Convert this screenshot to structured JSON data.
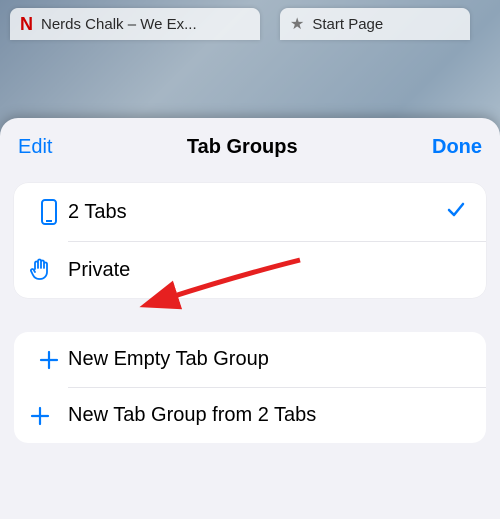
{
  "tabs_row": {
    "tab1": {
      "favicon_letter": "N",
      "title": "Nerds Chalk – We Ex..."
    },
    "tab2": {
      "title": "Start Page"
    }
  },
  "sheet": {
    "edit_label": "Edit",
    "title": "Tab Groups",
    "done_label": "Done"
  },
  "groups": {
    "tabs_count_label": "2 Tabs",
    "private_label": "Private"
  },
  "actions": {
    "new_empty_label": "New Empty Tab Group",
    "new_from_tabs_label": "New Tab Group from 2 Tabs"
  }
}
